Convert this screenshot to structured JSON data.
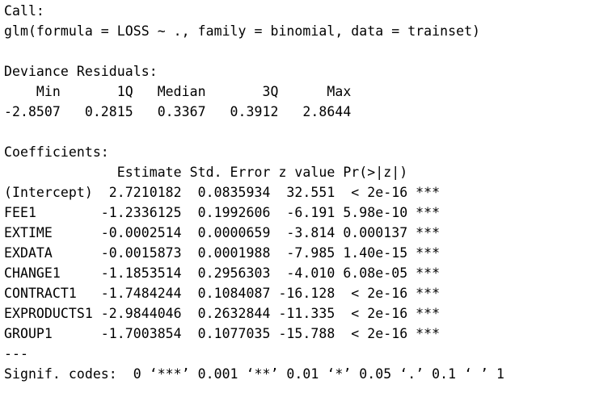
{
  "console": {
    "call_header": "Call:",
    "call_text": "glm(formula = LOSS ~ ., family = binomial, data = trainset)",
    "deviance_header": "Deviance Residuals:",
    "deviance_cols": "    Min       1Q   Median       3Q      Max  ",
    "deviance_vals": "-2.8507   0.2815   0.3367   0.3912   2.8644  ",
    "coef_header": "Coefficients:",
    "coef_cols": "              Estimate Std. Error z value Pr(>|z|)    ",
    "coef_rows": [
      "(Intercept)  2.7210182  0.0835934  32.551  < 2e-16 ***",
      "FEE1        -1.2336125  0.1992606  -6.191 5.98e-10 ***",
      "EXTIME      -0.0002514  0.0000659  -3.814 0.000137 ***",
      "EXDATA      -0.0015873  0.0001988  -7.985 1.40e-15 ***",
      "CHANGE1     -1.1853514  0.2956303  -4.010 6.08e-05 ***",
      "CONTRACT1   -1.7484244  0.1084087 -16.128  < 2e-16 ***",
      "EXPRODUCTS1 -2.9844046  0.2632844 -11.335  < 2e-16 ***",
      "GROUP1      -1.7003854  0.1077035 -15.788  < 2e-16 ***"
    ],
    "separator": "---",
    "signif_codes": "Signif. codes:  0 ‘***’ 0.001 ‘**’ 0.01 ‘*’ 0.05 ‘.’ 0.1 ‘ ’ 1"
  }
}
